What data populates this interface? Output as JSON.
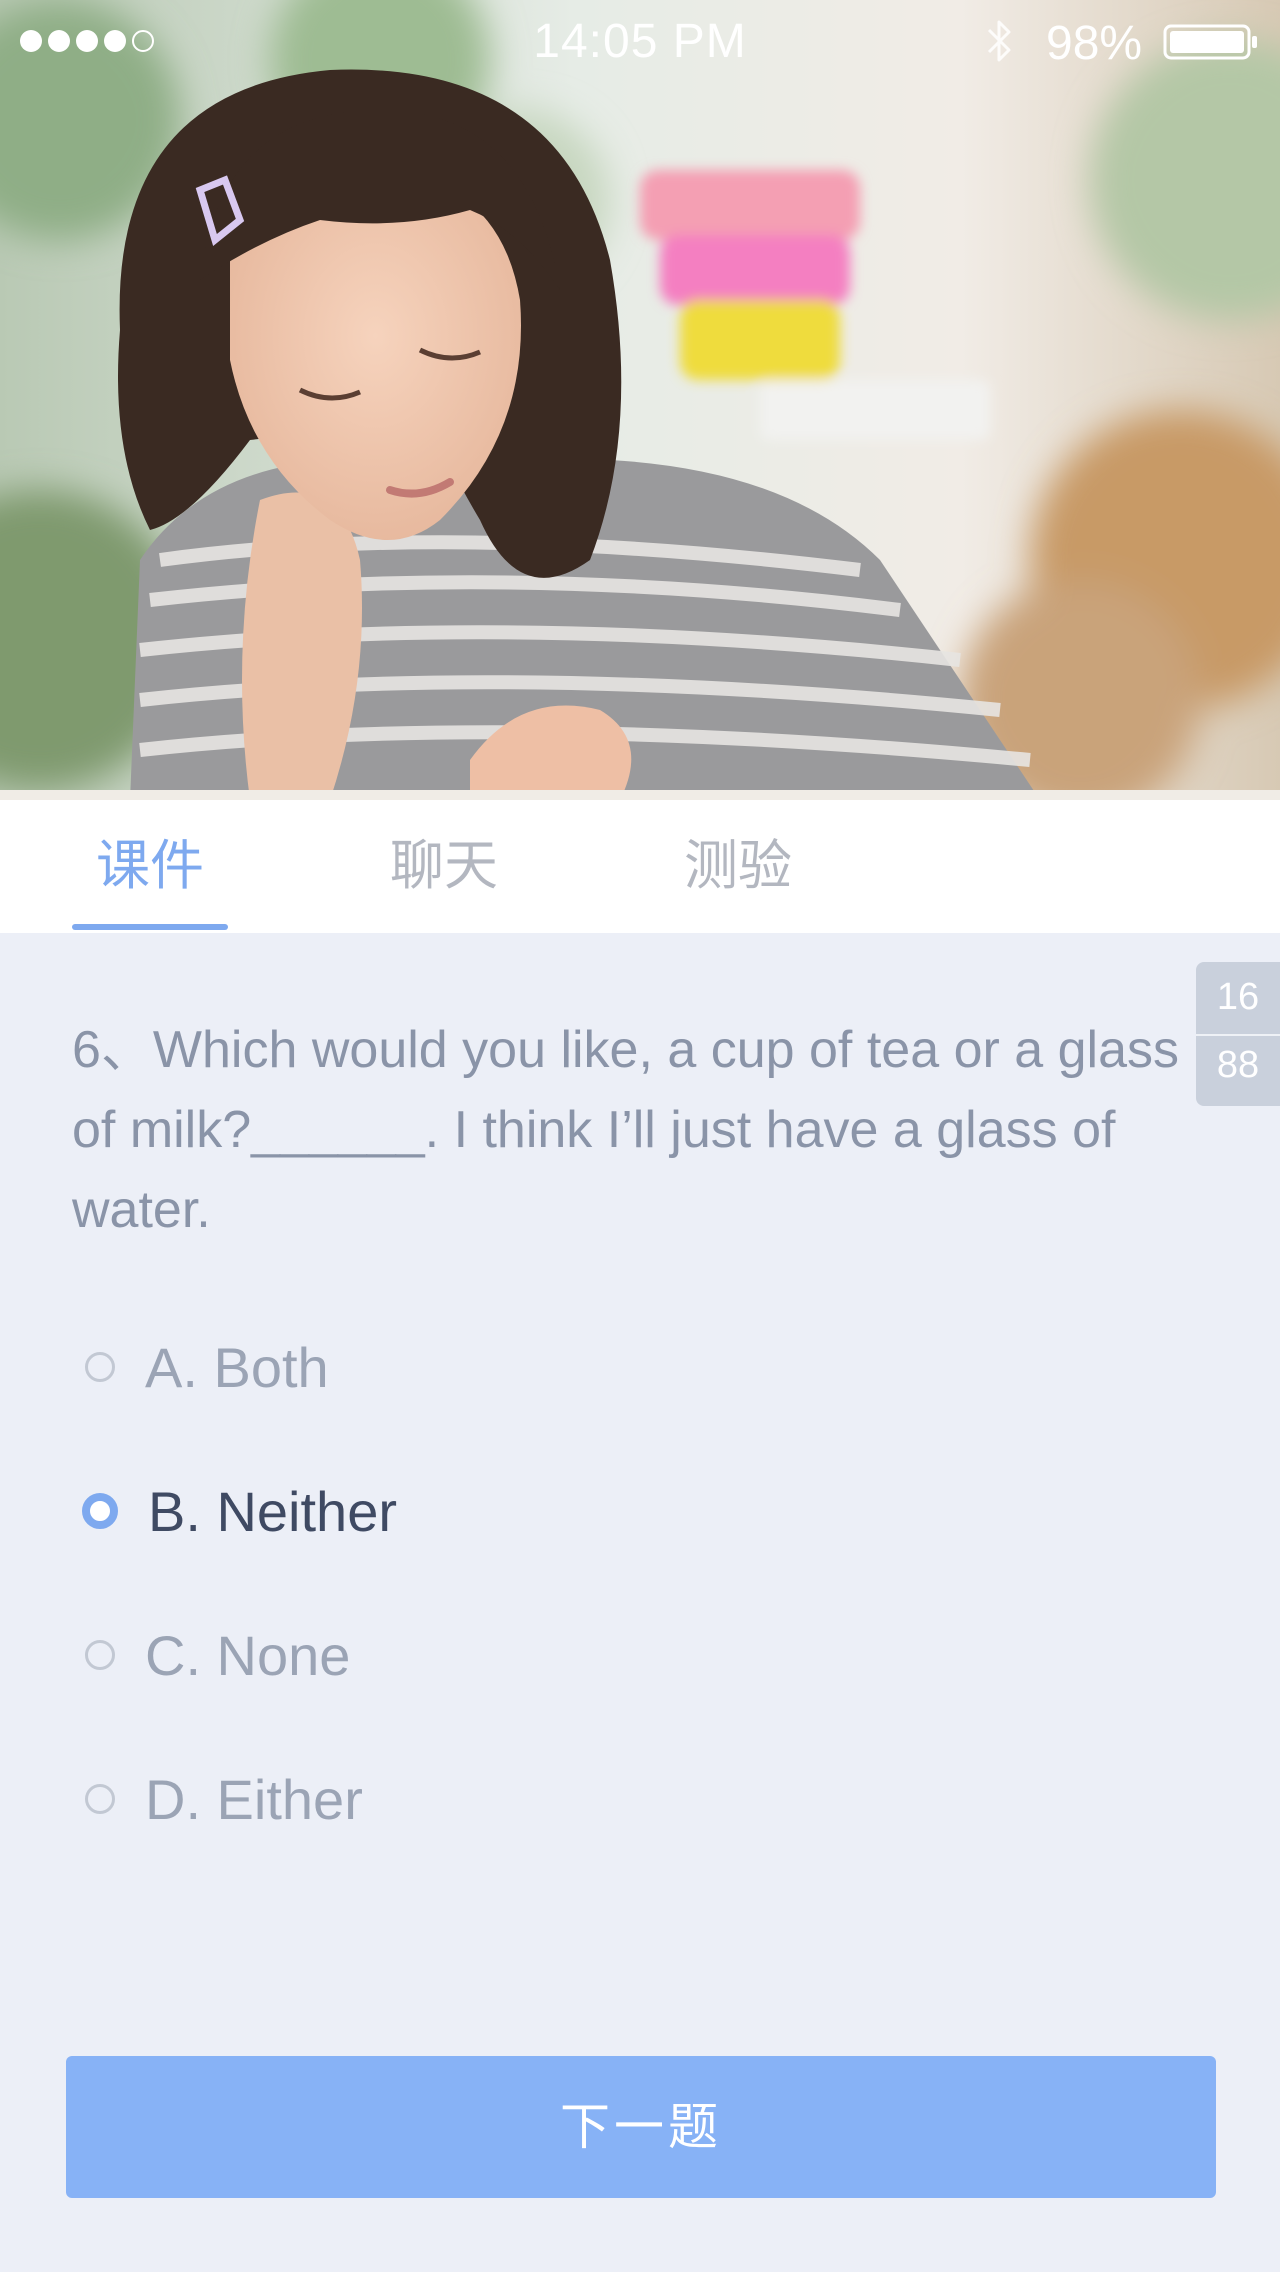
{
  "status_bar": {
    "time": "14:05 PM",
    "battery_percent": "98%",
    "signal_bars_filled": 4,
    "signal_bars_total": 5
  },
  "tabs": [
    {
      "label": "课件",
      "active": true
    },
    {
      "label": "聊天",
      "active": false
    },
    {
      "label": "测验",
      "active": false
    }
  ],
  "progress": {
    "current": "16",
    "total": "88"
  },
  "question": {
    "text": "6、Which would you like, a cup of tea or a glass of milk?______. I think I’ll just have a glass of water."
  },
  "options": [
    {
      "label": "A. Both",
      "selected": false
    },
    {
      "label": "B. Neither",
      "selected": true
    },
    {
      "label": "C. None",
      "selected": false
    },
    {
      "label": "D. Either",
      "selected": false
    }
  ],
  "next_button": {
    "label": "下一题"
  },
  "colors": {
    "accent": "#7ea9ef",
    "button": "#87b2f6",
    "background": "#eceff7",
    "question_text": "#8a94a8",
    "selected_text": "#3f4a63"
  },
  "icons": [
    "signal-dots-icon",
    "bluetooth-icon",
    "battery-icon"
  ]
}
